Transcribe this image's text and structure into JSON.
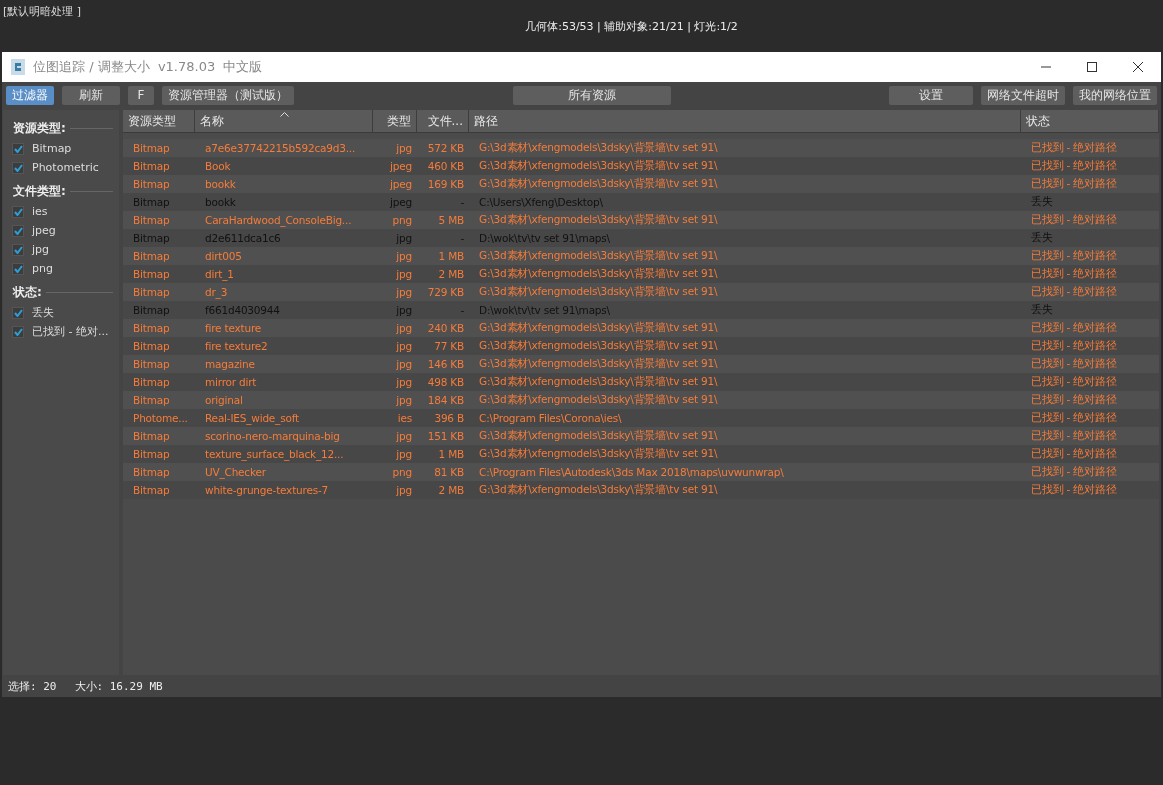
{
  "viewport": {
    "left_label": "[默认明暗处理 ]",
    "stats": "几何体:53/53 | 辅助对象:21/21 | 灯光:1/2"
  },
  "window": {
    "title": "位图追踪 / 调整大小  v1.78.03  中文版"
  },
  "toolbar": {
    "left": [
      {
        "label": "过滤器",
        "active": true
      },
      {
        "label": "刷新",
        "active": false
      },
      {
        "label": "F",
        "active": false
      },
      {
        "label": "资源管理器（测试版）",
        "active": false
      }
    ],
    "center": {
      "label": "所有资源",
      "active": false
    },
    "right": [
      {
        "label": "设置",
        "active": false
      },
      {
        "label": "网络文件超时",
        "active": false
      },
      {
        "label": "我的网络位置",
        "active": false
      }
    ]
  },
  "sidebar": {
    "sections": [
      {
        "title": "资源类型:",
        "items": [
          {
            "label": "Bitmap",
            "checked": true
          },
          {
            "label": "Photometric",
            "checked": true
          }
        ]
      },
      {
        "title": "文件类型:",
        "items": [
          {
            "label": "ies",
            "checked": true
          },
          {
            "label": "jpeg",
            "checked": true
          },
          {
            "label": "jpg",
            "checked": true
          },
          {
            "label": "png",
            "checked": true
          }
        ]
      },
      {
        "title": "状态:",
        "items": [
          {
            "label": "丢失",
            "checked": true
          },
          {
            "label": "已找到 - 绝对...",
            "checked": true
          }
        ]
      }
    ]
  },
  "table": {
    "columns": [
      {
        "label": "资源类型",
        "sorted": false
      },
      {
        "label": "名称",
        "sorted": true
      },
      {
        "label": "类型",
        "sorted": false
      },
      {
        "label": "文件...",
        "sorted": false
      },
      {
        "label": "路径",
        "sorted": false
      },
      {
        "label": "状态",
        "sorted": false
      }
    ],
    "rows": [
      {
        "found": true,
        "cells": [
          "Bitmap",
          "a7e6e37742215b592ca9d3...",
          "jpg",
          "572 KB",
          "G:\\3d素材\\xfengmodels\\3dsky\\背景墙\\tv set 91\\",
          "已找到 - 绝对路径"
        ]
      },
      {
        "found": true,
        "cells": [
          "Bitmap",
          "Book",
          "jpeg",
          "460 KB",
          "G:\\3d素材\\xfengmodels\\3dsky\\背景墙\\tv set 91\\",
          "已找到 - 绝对路径"
        ]
      },
      {
        "found": true,
        "cells": [
          "Bitmap",
          "bookk",
          "jpeg",
          "169 KB",
          "G:\\3d素材\\xfengmodels\\3dsky\\背景墙\\tv set 91\\",
          "已找到 - 绝对路径"
        ]
      },
      {
        "found": false,
        "cells": [
          "Bitmap",
          "bookk",
          "jpeg",
          "-",
          "C:\\Users\\Xfeng\\Desktop\\",
          "丢失"
        ]
      },
      {
        "found": true,
        "cells": [
          "Bitmap",
          "CaraHardwood_ConsoleBig...",
          "png",
          "5 MB",
          "G:\\3d素材\\xfengmodels\\3dsky\\背景墙\\tv set 91\\",
          "已找到 - 绝对路径"
        ]
      },
      {
        "found": false,
        "cells": [
          "Bitmap",
          "d2e611dca1c6",
          "jpg",
          "-",
          "D:\\wok\\tv\\tv set 91\\maps\\",
          "丢失"
        ]
      },
      {
        "found": true,
        "cells": [
          "Bitmap",
          "dirt005",
          "jpg",
          "1 MB",
          "G:\\3d素材\\xfengmodels\\3dsky\\背景墙\\tv set 91\\",
          "已找到 - 绝对路径"
        ]
      },
      {
        "found": true,
        "cells": [
          "Bitmap",
          "dirt_1",
          "jpg",
          "2 MB",
          "G:\\3d素材\\xfengmodels\\3dsky\\背景墙\\tv set 91\\",
          "已找到 - 绝对路径"
        ]
      },
      {
        "found": true,
        "cells": [
          "Bitmap",
          "dr_3",
          "jpg",
          "729 KB",
          "G:\\3d素材\\xfengmodels\\3dsky\\背景墙\\tv set 91\\",
          "已找到 - 绝对路径"
        ]
      },
      {
        "found": false,
        "cells": [
          "Bitmap",
          "f661d4030944",
          "jpg",
          "-",
          "D:\\wok\\tv\\tv set 91\\maps\\",
          "丢失"
        ]
      },
      {
        "found": true,
        "cells": [
          "Bitmap",
          "fire texture",
          "jpg",
          "240 KB",
          "G:\\3d素材\\xfengmodels\\3dsky\\背景墙\\tv set 91\\",
          "已找到 - 绝对路径"
        ]
      },
      {
        "found": true,
        "cells": [
          "Bitmap",
          "fire texture2",
          "jpg",
          "77 KB",
          "G:\\3d素材\\xfengmodels\\3dsky\\背景墙\\tv set 91\\",
          "已找到 - 绝对路径"
        ]
      },
      {
        "found": true,
        "cells": [
          "Bitmap",
          "magazine",
          "jpg",
          "146 KB",
          "G:\\3d素材\\xfengmodels\\3dsky\\背景墙\\tv set 91\\",
          "已找到 - 绝对路径"
        ]
      },
      {
        "found": true,
        "cells": [
          "Bitmap",
          "mirror dirt",
          "jpg",
          "498 KB",
          "G:\\3d素材\\xfengmodels\\3dsky\\背景墙\\tv set 91\\",
          "已找到 - 绝对路径"
        ]
      },
      {
        "found": true,
        "cells": [
          "Bitmap",
          "original",
          "jpg",
          "184 KB",
          "G:\\3d素材\\xfengmodels\\3dsky\\背景墙\\tv set 91\\",
          "已找到 - 绝对路径"
        ]
      },
      {
        "found": true,
        "cells": [
          "Photome...",
          "Real-IES_wide_soft",
          "ies",
          "396 B",
          "C:\\Program Files\\Corona\\ies\\",
          "已找到 - 绝对路径"
        ]
      },
      {
        "found": true,
        "cells": [
          "Bitmap",
          "scorino-nero-marquina-big",
          "jpg",
          "151 KB",
          "G:\\3d素材\\xfengmodels\\3dsky\\背景墙\\tv set 91\\",
          "已找到 - 绝对路径"
        ]
      },
      {
        "found": true,
        "cells": [
          "Bitmap",
          "texture_surface_black_12...",
          "jpg",
          "1 MB",
          "G:\\3d素材\\xfengmodels\\3dsky\\背景墙\\tv set 91\\",
          "已找到 - 绝对路径"
        ]
      },
      {
        "found": true,
        "cells": [
          "Bitmap",
          "UV_Checker",
          "png",
          "81 KB",
          "C:\\Program Files\\Autodesk\\3ds Max 2018\\maps\\uvwunwrap\\",
          "已找到 - 绝对路径"
        ]
      },
      {
        "found": true,
        "cells": [
          "Bitmap",
          "white-grunge-textures-7",
          "jpg",
          "2 MB",
          "G:\\3d素材\\xfengmodels\\3dsky\\背景墙\\tv set 91\\",
          "已找到 - 绝对路径"
        ]
      }
    ]
  },
  "status_bar": {
    "selection": "选择: 20",
    "size": "大小: 16.29 MB"
  }
}
